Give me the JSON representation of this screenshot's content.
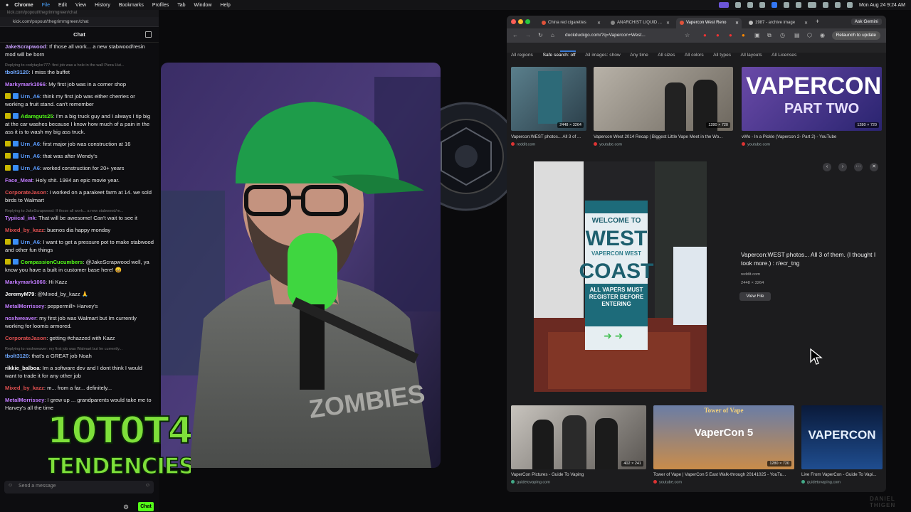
{
  "menubar": {
    "app": "Chrome",
    "items": [
      "File",
      "Edit",
      "View",
      "History",
      "Bookmarks",
      "Profiles",
      "Tab",
      "Window",
      "Help"
    ],
    "clock": "Mon Aug 24  9:24 AM"
  },
  "chat": {
    "url_faded": "kick.com/popout/thegrimmgreen/chat",
    "url": "kick.com/popout/thegrimmgreen/chat",
    "header": "Chat",
    "messages": [
      {
        "user": "JakeScrapwood",
        "color": "#c9a0ff",
        "text": ": If those all work... a new stabwood/resin mod will be born",
        "reply": ""
      },
      {
        "user": "tbolt3120",
        "color": "#6fa8ff",
        "text": ": I miss the buffet",
        "reply": "Replying to codytaylor777: first job was a hole in the wall Pizza Hut..."
      },
      {
        "user": "Markymark1066",
        "color": "#c27cff",
        "text": ": My first job was in a corner shop",
        "reply": ""
      },
      {
        "user": "Urn_A6",
        "color": "#5b9cff",
        "text": ": think my first job was either cherries or working a fruit stand. can't remember",
        "reply": "",
        "badges": true
      },
      {
        "user": "Adamguts25",
        "color": "#53fc18",
        "text": ": I'm a big truck guy and I always I tip big at the car washes because I know how much of a pain in the ass it is to wash my big ass truck.",
        "reply": "",
        "badges": true
      },
      {
        "user": "Urn_A6",
        "color": "#5b9cff",
        "text": ": first major job was construction at 16",
        "reply": "",
        "badges": true
      },
      {
        "user": "Urn_A6",
        "color": "#5b9cff",
        "text": ": that was after Wendy's",
        "reply": "",
        "badges": true
      },
      {
        "user": "Urn_A6",
        "color": "#5b9cff",
        "text": ": worked construction for 20+ years",
        "reply": "",
        "badges": true
      },
      {
        "user": "Face_Meat",
        "color": "#c27cff",
        "text": ": Holy shit. 1984 an epic movie year.",
        "reply": ""
      },
      {
        "user": "CorporateJason",
        "color": "#e05050",
        "text": ": I worked on a parakeet farm at 14. we sold birds to Walmart",
        "reply": ""
      },
      {
        "user": "Typiical_ink",
        "color": "#c27cff",
        "text": ": That will be awesome! Can't wait to see it",
        "reply": "Replying to JakeScrapwood: If those all work... a new stabwood/re..."
      },
      {
        "user": "Mixed_by_kazz",
        "color": "#e05050",
        "text": ": buenos dia happy monday",
        "reply": ""
      },
      {
        "user": "Urn_A6",
        "color": "#5b9cff",
        "text": ": I want to get a pressure pot to make stabwood and other fun things",
        "reply": "",
        "badges": true
      },
      {
        "user": "CompassionCucumbers",
        "color": "#53fc18",
        "text": ": @JakeScrapwood well, ya know you have a built in customer base here! 😄",
        "reply": "",
        "badges": true
      },
      {
        "user": "Markymark1066",
        "color": "#c27cff",
        "text": ": Hi Kazz",
        "reply": ""
      },
      {
        "user": "JeremyM79",
        "color": "#ffffff",
        "text": ": @Mixed_by_kazz 🙏",
        "reply": ""
      },
      {
        "user": "MetalMorrissey",
        "color": "#c27cff",
        "text": ": peppermill> Harvey's",
        "reply": ""
      },
      {
        "user": "noxhweaver",
        "color": "#c27cff",
        "text": ": my first job was Walmart but Im currently working for loomis armored.",
        "reply": ""
      },
      {
        "user": "CorporateJason",
        "color": "#e05050",
        "text": ": getting #chazzed with Kazz",
        "reply": ""
      },
      {
        "user": "tbolt3120",
        "color": "#6fa8ff",
        "text": ": that's a GREAT job Noah",
        "reply": "Replying to noxhweaver: my first job was Walmart but Im currently..."
      },
      {
        "user": "rikkie_balboa",
        "color": "#ffffff",
        "text": ": Im a software dev and I dont think I would want to trade it for any other job",
        "reply": ""
      },
      {
        "user": "Mixed_by_kazz",
        "color": "#e05050",
        "text": ": m... from a far... definitely...",
        "reply": ""
      },
      {
        "user": "MetalMorrissey",
        "color": "#c27cff",
        "text": ": I grew up ... grandparents would take me to Harvey's all the time",
        "reply": ""
      }
    ],
    "input_placeholder": "Send a message",
    "send_label": "Chat"
  },
  "overlay": {
    "logo_line1": "10T0T4",
    "logo_line2": "TENDENCIES",
    "shirt_text": "ZOMBIES",
    "watermark": "DANIEL THIGEN"
  },
  "browser": {
    "tabs": [
      {
        "label": "China red cigarettes"
      },
      {
        "label": "ANARCHIST LIQUID ..."
      },
      {
        "label": "Vapercon West Reno"
      },
      {
        "label": "1987 - archive image"
      }
    ],
    "ask_gemini": "Ask Gemini",
    "url": "duckduckgo.com/?q=Vapercon+West...",
    "relaunch": "Relaunch to update",
    "filters": [
      "All regions",
      "Safe search: off",
      "All images: show",
      "Any time",
      "All sizes",
      "All colors",
      "All types",
      "All layouts",
      "All Licenses"
    ],
    "top_results": [
      {
        "dims": "2448 × 3264",
        "caption": "Vapercon:WEST photos... All 3 of ...",
        "source": "reddit.com"
      },
      {
        "dims": "1280 × 720",
        "caption": "Vapercon West 2014 Recap | Biggest Little Vape Meet in the Wo...",
        "source": "youtube.com"
      },
      {
        "dims": "1280 × 720",
        "caption": "vWo - In a Pickle (Vapercon 2- Part 2) - YouTube",
        "source": "youtube.com",
        "thumb_text_1": "VAPERCON",
        "thumb_text_2": "PART TWO"
      }
    ],
    "preview": {
      "sign_line1": "WELCOME TO",
      "sign_line2": "WEST",
      "sign_line3": "VAPERCON WEST",
      "sign_line4": "COAST",
      "sign_line5": "ALL VAPERS MUST REGISTER BEFORE ENTERING",
      "title": "Vapercon:WEST photos... All 3 of them. (I thought I took more.) : r/ecr_tng",
      "source": "reddit.com",
      "dims": "2448 × 3264",
      "view_file": "View File"
    },
    "bottom_results": [
      {
        "dims": "402 × 241",
        "caption": "VaperCon Pictures - Guide To Vaping",
        "source": "guidetovaping.com"
      },
      {
        "dims": "1280 × 720",
        "caption": "Tower of Vape | VaperCon 5 East Walk-through 20141025 - YouTu...",
        "source": "youtube.com",
        "thumb_text_1": "Tower of Vape",
        "thumb_text_2": "VaperCon 5"
      },
      {
        "dims": "",
        "caption": "Live From VaperCon - Guide To Vapi...",
        "source": "guidetovaping.com",
        "thumb_text_1": "VAPERCON"
      }
    ]
  }
}
